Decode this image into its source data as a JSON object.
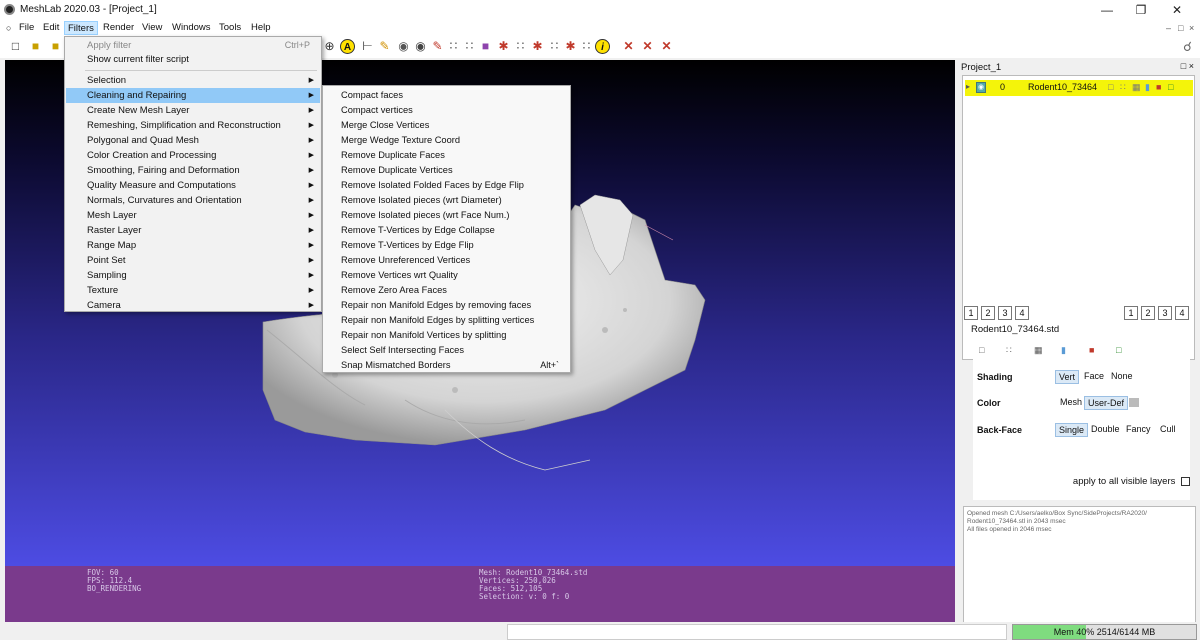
{
  "window": {
    "title": "MeshLab 2020.03 - [Project_1]"
  },
  "menubar": {
    "items": [
      "File",
      "Edit",
      "Filters",
      "Render",
      "View",
      "Windows",
      "Tools",
      "Help"
    ],
    "active": "Filters"
  },
  "filters_menu": {
    "top_items": [
      {
        "label": "Apply filter",
        "shortcut": "Ctrl+P",
        "disabled": true
      },
      {
        "label": "Show current filter script",
        "shortcut": "",
        "disabled": false
      }
    ],
    "categories": [
      "Selection",
      "Cleaning and Repairing",
      "Create New Mesh Layer",
      "Remeshing, Simplification and Reconstruction",
      "Polygonal and Quad Mesh",
      "Color Creation and Processing",
      "Smoothing, Fairing and Deformation",
      "Quality Measure and Computations",
      "Normals, Curvatures and Orientation",
      "Mesh Layer",
      "Raster Layer",
      "Range Map",
      "Point Set",
      "Sampling",
      "Texture",
      "Camera"
    ],
    "highlighted": "Cleaning and Repairing"
  },
  "submenu": {
    "items": [
      {
        "label": "Compact faces",
        "shortcut": ""
      },
      {
        "label": "Compact vertices",
        "shortcut": ""
      },
      {
        "label": "Merge Close Vertices",
        "shortcut": ""
      },
      {
        "label": "Merge Wedge Texture Coord",
        "shortcut": ""
      },
      {
        "label": "Remove Duplicate Faces",
        "shortcut": ""
      },
      {
        "label": "Remove Duplicate Vertices",
        "shortcut": ""
      },
      {
        "label": "Remove Isolated Folded Faces by Edge Flip",
        "shortcut": ""
      },
      {
        "label": "Remove Isolated pieces (wrt Diameter)",
        "shortcut": ""
      },
      {
        "label": "Remove Isolated pieces (wrt Face Num.)",
        "shortcut": ""
      },
      {
        "label": "Remove T-Vertices by Edge Collapse",
        "shortcut": ""
      },
      {
        "label": "Remove T-Vertices by Edge Flip",
        "shortcut": ""
      },
      {
        "label": "Remove Unreferenced Vertices",
        "shortcut": ""
      },
      {
        "label": "Remove Vertices wrt Quality",
        "shortcut": ""
      },
      {
        "label": "Remove Zero Area Faces",
        "shortcut": ""
      },
      {
        "label": "Repair non Manifold Edges by removing faces",
        "shortcut": ""
      },
      {
        "label": "Repair non Manifold Edges by splitting vertices",
        "shortcut": ""
      },
      {
        "label": "Repair non Manifold Vertices by splitting",
        "shortcut": ""
      },
      {
        "label": "Select Self Intersecting Faces",
        "shortcut": ""
      },
      {
        "label": "Snap Mismatched Borders",
        "shortcut": "Alt+`"
      }
    ]
  },
  "viewport_status": {
    "left": {
      "fov": "FOV: 60",
      "fps": "FPS:  112.4",
      "mode": "BO_RENDERING"
    },
    "center": {
      "mesh": "Mesh: Rodent10_73464.std",
      "vertices": "Vertices: 250,026",
      "faces": "Faces: 512,105",
      "selection": "Selection: v: 0 f: 0"
    }
  },
  "layer_panel": {
    "title": "Project_1",
    "layer": {
      "index": "0",
      "name": "Rodent10_73464"
    },
    "tab_numbers": [
      "1",
      "2",
      "3",
      "4"
    ],
    "mesh_name": "Rodent10_73464.std",
    "shading": {
      "label": "Shading",
      "options": [
        "Vert",
        "Face",
        "None"
      ],
      "selected": "Vert"
    },
    "color": {
      "label": "Color",
      "options": [
        "Mesh",
        "User-Def"
      ],
      "selected": "User-Def"
    },
    "backface": {
      "label": "Back-Face",
      "options": [
        "Single",
        "Double",
        "Fancy",
        "Cull"
      ],
      "selected": "Single"
    },
    "apply_all": "apply to all visible layers"
  },
  "log": {
    "lines": [
      "Opened mesh C:/Users/aelko/Box Sync/SideProjects/RA2020/",
      "Rodent10_73464.stl in 2043 msec",
      "All files opened in 2046 msec"
    ]
  },
  "memory": {
    "text": "Mem 40% 2514/6144 MB",
    "percent": 40
  },
  "colors": {
    "status_bar": "#7a3a8c",
    "layer_highlight": "#f4f40a",
    "menu_highlight": "#91c9f7",
    "memory_fill": "#7fdc7f"
  }
}
